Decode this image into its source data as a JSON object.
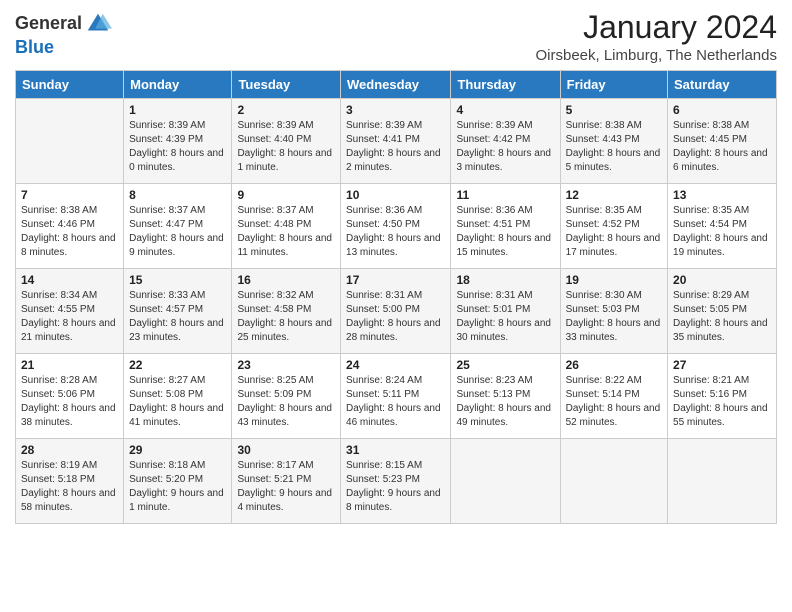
{
  "logo": {
    "general": "General",
    "blue": "Blue"
  },
  "title": "January 2024",
  "location": "Oirsbeek, Limburg, The Netherlands",
  "weekdays": [
    "Sunday",
    "Monday",
    "Tuesday",
    "Wednesday",
    "Thursday",
    "Friday",
    "Saturday"
  ],
  "weeks": [
    [
      {
        "day": "",
        "sunrise": "",
        "sunset": "",
        "daylight": ""
      },
      {
        "day": "1",
        "sunrise": "Sunrise: 8:39 AM",
        "sunset": "Sunset: 4:39 PM",
        "daylight": "Daylight: 8 hours and 0 minutes."
      },
      {
        "day": "2",
        "sunrise": "Sunrise: 8:39 AM",
        "sunset": "Sunset: 4:40 PM",
        "daylight": "Daylight: 8 hours and 1 minute."
      },
      {
        "day": "3",
        "sunrise": "Sunrise: 8:39 AM",
        "sunset": "Sunset: 4:41 PM",
        "daylight": "Daylight: 8 hours and 2 minutes."
      },
      {
        "day": "4",
        "sunrise": "Sunrise: 8:39 AM",
        "sunset": "Sunset: 4:42 PM",
        "daylight": "Daylight: 8 hours and 3 minutes."
      },
      {
        "day": "5",
        "sunrise": "Sunrise: 8:38 AM",
        "sunset": "Sunset: 4:43 PM",
        "daylight": "Daylight: 8 hours and 5 minutes."
      },
      {
        "day": "6",
        "sunrise": "Sunrise: 8:38 AM",
        "sunset": "Sunset: 4:45 PM",
        "daylight": "Daylight: 8 hours and 6 minutes."
      }
    ],
    [
      {
        "day": "7",
        "sunrise": "Sunrise: 8:38 AM",
        "sunset": "Sunset: 4:46 PM",
        "daylight": "Daylight: 8 hours and 8 minutes."
      },
      {
        "day": "8",
        "sunrise": "Sunrise: 8:37 AM",
        "sunset": "Sunset: 4:47 PM",
        "daylight": "Daylight: 8 hours and 9 minutes."
      },
      {
        "day": "9",
        "sunrise": "Sunrise: 8:37 AM",
        "sunset": "Sunset: 4:48 PM",
        "daylight": "Daylight: 8 hours and 11 minutes."
      },
      {
        "day": "10",
        "sunrise": "Sunrise: 8:36 AM",
        "sunset": "Sunset: 4:50 PM",
        "daylight": "Daylight: 8 hours and 13 minutes."
      },
      {
        "day": "11",
        "sunrise": "Sunrise: 8:36 AM",
        "sunset": "Sunset: 4:51 PM",
        "daylight": "Daylight: 8 hours and 15 minutes."
      },
      {
        "day": "12",
        "sunrise": "Sunrise: 8:35 AM",
        "sunset": "Sunset: 4:52 PM",
        "daylight": "Daylight: 8 hours and 17 minutes."
      },
      {
        "day": "13",
        "sunrise": "Sunrise: 8:35 AM",
        "sunset": "Sunset: 4:54 PM",
        "daylight": "Daylight: 8 hours and 19 minutes."
      }
    ],
    [
      {
        "day": "14",
        "sunrise": "Sunrise: 8:34 AM",
        "sunset": "Sunset: 4:55 PM",
        "daylight": "Daylight: 8 hours and 21 minutes."
      },
      {
        "day": "15",
        "sunrise": "Sunrise: 8:33 AM",
        "sunset": "Sunset: 4:57 PM",
        "daylight": "Daylight: 8 hours and 23 minutes."
      },
      {
        "day": "16",
        "sunrise": "Sunrise: 8:32 AM",
        "sunset": "Sunset: 4:58 PM",
        "daylight": "Daylight: 8 hours and 25 minutes."
      },
      {
        "day": "17",
        "sunrise": "Sunrise: 8:31 AM",
        "sunset": "Sunset: 5:00 PM",
        "daylight": "Daylight: 8 hours and 28 minutes."
      },
      {
        "day": "18",
        "sunrise": "Sunrise: 8:31 AM",
        "sunset": "Sunset: 5:01 PM",
        "daylight": "Daylight: 8 hours and 30 minutes."
      },
      {
        "day": "19",
        "sunrise": "Sunrise: 8:30 AM",
        "sunset": "Sunset: 5:03 PM",
        "daylight": "Daylight: 8 hours and 33 minutes."
      },
      {
        "day": "20",
        "sunrise": "Sunrise: 8:29 AM",
        "sunset": "Sunset: 5:05 PM",
        "daylight": "Daylight: 8 hours and 35 minutes."
      }
    ],
    [
      {
        "day": "21",
        "sunrise": "Sunrise: 8:28 AM",
        "sunset": "Sunset: 5:06 PM",
        "daylight": "Daylight: 8 hours and 38 minutes."
      },
      {
        "day": "22",
        "sunrise": "Sunrise: 8:27 AM",
        "sunset": "Sunset: 5:08 PM",
        "daylight": "Daylight: 8 hours and 41 minutes."
      },
      {
        "day": "23",
        "sunrise": "Sunrise: 8:25 AM",
        "sunset": "Sunset: 5:09 PM",
        "daylight": "Daylight: 8 hours and 43 minutes."
      },
      {
        "day": "24",
        "sunrise": "Sunrise: 8:24 AM",
        "sunset": "Sunset: 5:11 PM",
        "daylight": "Daylight: 8 hours and 46 minutes."
      },
      {
        "day": "25",
        "sunrise": "Sunrise: 8:23 AM",
        "sunset": "Sunset: 5:13 PM",
        "daylight": "Daylight: 8 hours and 49 minutes."
      },
      {
        "day": "26",
        "sunrise": "Sunrise: 8:22 AM",
        "sunset": "Sunset: 5:14 PM",
        "daylight": "Daylight: 8 hours and 52 minutes."
      },
      {
        "day": "27",
        "sunrise": "Sunrise: 8:21 AM",
        "sunset": "Sunset: 5:16 PM",
        "daylight": "Daylight: 8 hours and 55 minutes."
      }
    ],
    [
      {
        "day": "28",
        "sunrise": "Sunrise: 8:19 AM",
        "sunset": "Sunset: 5:18 PM",
        "daylight": "Daylight: 8 hours and 58 minutes."
      },
      {
        "day": "29",
        "sunrise": "Sunrise: 8:18 AM",
        "sunset": "Sunset: 5:20 PM",
        "daylight": "Daylight: 9 hours and 1 minute."
      },
      {
        "day": "30",
        "sunrise": "Sunrise: 8:17 AM",
        "sunset": "Sunset: 5:21 PM",
        "daylight": "Daylight: 9 hours and 4 minutes."
      },
      {
        "day": "31",
        "sunrise": "Sunrise: 8:15 AM",
        "sunset": "Sunset: 5:23 PM",
        "daylight": "Daylight: 9 hours and 8 minutes."
      },
      {
        "day": "",
        "sunrise": "",
        "sunset": "",
        "daylight": ""
      },
      {
        "day": "",
        "sunrise": "",
        "sunset": "",
        "daylight": ""
      },
      {
        "day": "",
        "sunrise": "",
        "sunset": "",
        "daylight": ""
      }
    ]
  ]
}
